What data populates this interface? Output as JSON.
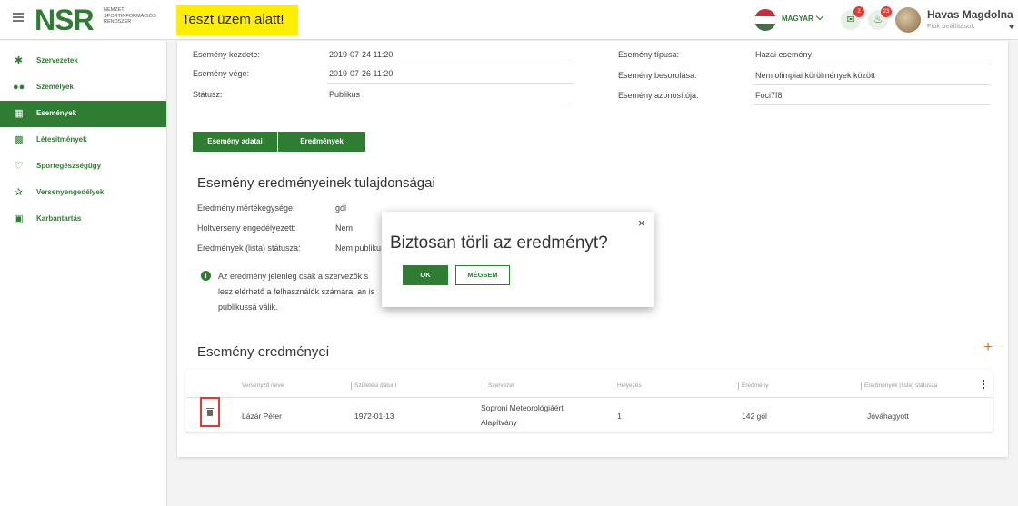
{
  "header": {
    "logo": "NSR",
    "logo_sub": "Nemzeti Sportinformációs Rendszer",
    "test_banner": "Teszt üzem alatt!",
    "language": "MAGYAR",
    "messages_badge": "2",
    "notifications_badge": "23",
    "user_name": "Havas Magdolna",
    "user_sub": "Fiók beállítások"
  },
  "sidebar": {
    "items": [
      {
        "label": "Szervezetek",
        "icon": "org-icon"
      },
      {
        "label": "Személyek",
        "icon": "people-icon"
      },
      {
        "label": "Események",
        "icon": "calendar-icon"
      },
      {
        "label": "Létesítmények",
        "icon": "building-icon"
      },
      {
        "label": "Sportegészségügy",
        "icon": "heart-icon"
      },
      {
        "label": "Versenyengedélyek",
        "icon": "runner-icon"
      },
      {
        "label": "Karbantartás",
        "icon": "clipboard-icon"
      }
    ],
    "active_index": 2
  },
  "event": {
    "left": [
      {
        "label": "Esemény kezdete:",
        "value": "2019-07-24 11:20"
      },
      {
        "label": "Esemény vége:",
        "value": "2019-07-26 11:20"
      },
      {
        "label": "Státusz:",
        "value": "Publikus"
      }
    ],
    "right": [
      {
        "label": "Esemény típusa:",
        "value": "Hazai esemény"
      },
      {
        "label": "Esemény besorolása:",
        "value": "Nem olimpiai körülmények között"
      },
      {
        "label": "Esemény azonosítója:",
        "value": "Foci7f8"
      }
    ]
  },
  "tabs": [
    "Esemény adatai",
    "Eredmények"
  ],
  "properties": {
    "title": "Esemény eredményeinek tulajdonságai",
    "rows": [
      {
        "label": "Eredmény mértékegysége:",
        "value": "gól"
      },
      {
        "label": "Holtverseny engedélyezett:",
        "value": "Nem"
      },
      {
        "label": "Eredmények (lista) státusza:",
        "value": "Nem publiku"
      }
    ],
    "info": "Az eredmény jelenleg csak a szervezők s lesz elérhető a felhasználók számára, an is publikussá válik."
  },
  "results": {
    "title": "Esemény eredményei",
    "columns": [
      "Versenyző neve",
      "Születési dátum",
      "Szervezet",
      "Helyezés",
      "Eredmény",
      "Eredmények (lista) státusza"
    ],
    "rows": [
      {
        "name": "Lázár Péter",
        "birth": "1972-01-13",
        "org_line1": "Soproni Meteorológiáért",
        "org_line2": "Alapítvány",
        "place": "1",
        "result": "142 gól",
        "status": "Jóváhagyott"
      }
    ]
  },
  "dialog": {
    "title": "Biztosan törli az eredményt?",
    "ok": "OK",
    "cancel": "MÉGSEM",
    "close": "×"
  }
}
